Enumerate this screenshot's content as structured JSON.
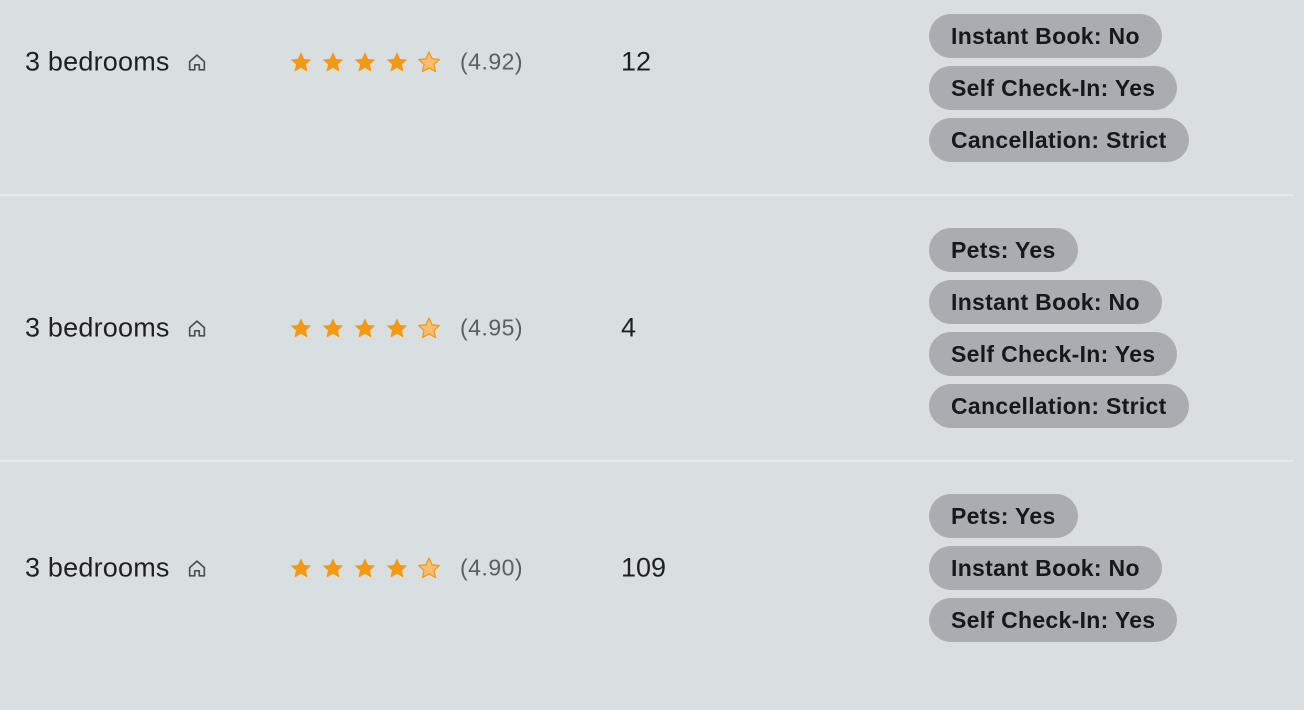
{
  "rows": [
    {
      "bedrooms": "3 bedrooms",
      "rating_text": "(4.92)",
      "rating": 4.92,
      "count": "12",
      "tags": [
        "Instant Book: No",
        "Self Check-In: Yes",
        "Cancellation: Strict"
      ]
    },
    {
      "bedrooms": "3 bedrooms",
      "rating_text": "(4.95)",
      "rating": 4.95,
      "count": "4",
      "tags": [
        "Pets: Yes",
        "Instant Book: No",
        "Self Check-In: Yes",
        "Cancellation: Strict"
      ]
    },
    {
      "bedrooms": "3 bedrooms",
      "rating_text": "(4.90)",
      "rating": 4.9,
      "count": "109",
      "tags": [
        "Pets: Yes",
        "Instant Book: No",
        "Self Check-In: Yes"
      ]
    }
  ],
  "icons": {
    "bedroom_icon": "home-icon",
    "star_full": "star-icon",
    "star_partial": "star-half-icon"
  },
  "colors": {
    "star_fill": "#f39a12",
    "star_partial": "#f6be72",
    "tag_bg": "#a9adb2",
    "row_bg": "#d9dfe1"
  }
}
